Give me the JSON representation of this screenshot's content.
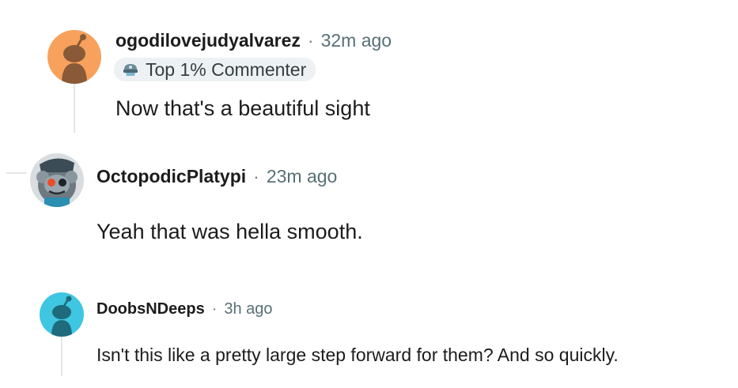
{
  "comments": [
    {
      "username": "ogodilovejudyalvarez",
      "separator": "·",
      "time": "32m ago",
      "badge": {
        "label": "Top 1% Commenter",
        "icon": "top-commenter-icon"
      },
      "text": "Now that's a beautiful sight",
      "avatar": {
        "icon": "snoo-avatar-icon",
        "bg": "#f7a15c",
        "figure": "#8a5a38"
      }
    },
    {
      "username": "OctopodicPlatypi",
      "separator": "·",
      "time": "23m ago",
      "text": "Yeah that was hella smooth.",
      "avatar": {
        "icon": "custom-avatar-icon",
        "bg": "#d9dde0"
      }
    },
    {
      "username": "DoobsNDeeps",
      "separator": "·",
      "time": "3h ago",
      "text": "Isn't this like a pretty large step forward for them? And so quickly.",
      "avatar": {
        "icon": "snoo-avatar-icon",
        "bg": "#3fc6e0",
        "figure": "#1d6b7c"
      }
    }
  ],
  "colors": {
    "thread_line": "#e3e6e8",
    "muted": "#576f76",
    "badge_bg": "#eef1f3"
  }
}
